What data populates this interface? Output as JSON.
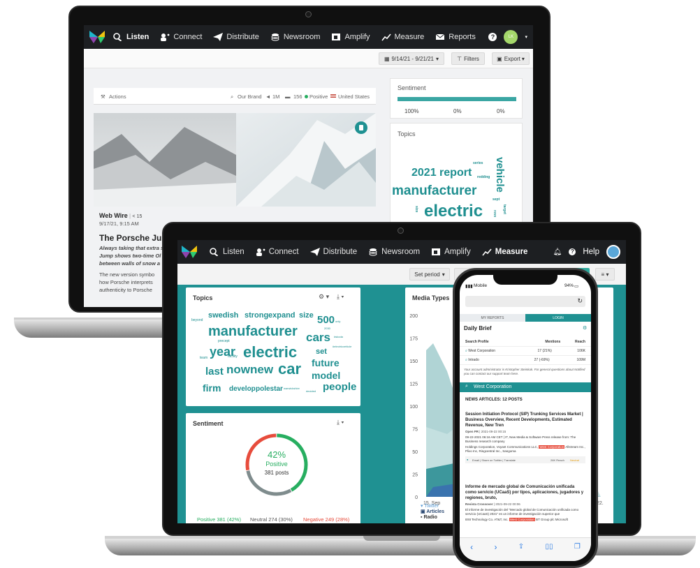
{
  "back_laptop": {
    "nav": {
      "items": [
        {
          "label": "Listen",
          "icon": "listen-icon",
          "active": true
        },
        {
          "label": "Connect",
          "icon": "connect-icon"
        },
        {
          "label": "Distribute",
          "icon": "distribute-icon"
        },
        {
          "label": "Newsroom",
          "icon": "newsroom-icon"
        },
        {
          "label": "Amplify",
          "icon": "amplify-icon"
        },
        {
          "label": "Measure",
          "icon": "measure-icon"
        },
        {
          "label": "Reports",
          "icon": "mail-icon"
        }
      ],
      "help": "?",
      "avatar": "LK"
    },
    "toolbar": {
      "date_range": "9/14/21 - 9/21/21",
      "filters": "Filters",
      "export": "Export"
    },
    "actions": {
      "label": "Actions",
      "brand": "Our Brand",
      "reach": "1M",
      "mentions": "156",
      "sentiment": "Positive",
      "country": "United States"
    },
    "article": {
      "source": "Web Wire",
      "shares": "15",
      "date": "9/17/21, 9:15 AM",
      "title": "The Porsche Jur",
      "lede": [
        "Always taking that extra s",
        "Jump shows two-time Ol",
        "between walls of snow a"
      ],
      "body": [
        "The new version symbo",
        "how Porsche interprets",
        "authenticity to Porsche"
      ]
    },
    "sentiment": {
      "title": "Sentiment",
      "values": [
        "100%",
        "0%",
        "0%"
      ]
    },
    "topics": {
      "title": "Topics",
      "words": [
        "2021 report",
        "manufacturer",
        "electric",
        "vehicle",
        "series",
        "redding",
        "sept",
        "target",
        "reve",
        "size"
      ]
    }
  },
  "front_laptop": {
    "nav": {
      "items": [
        {
          "label": "Listen",
          "icon": "listen-icon"
        },
        {
          "label": "Connect",
          "icon": "connect-icon"
        },
        {
          "label": "Distribute",
          "icon": "distribute-icon"
        },
        {
          "label": "Newsroom",
          "icon": "newsroom-icon"
        },
        {
          "label": "Amplify",
          "icon": "amplify-icon"
        },
        {
          "label": "Measure",
          "icon": "measure-icon",
          "active": true
        }
      ],
      "help": "Help"
    },
    "toolbar": {
      "set_period": "Set period"
    },
    "topics": {
      "title": "Topics",
      "words": [
        {
          "t": "beyond",
          "s": 5
        },
        {
          "t": "swedish",
          "s": 11
        },
        {
          "t": "strong",
          "s": 11
        },
        {
          "t": "expand",
          "s": 11
        },
        {
          "t": "size",
          "s": 11
        },
        {
          "t": "500",
          "s": 15
        },
        {
          "t": "manufacturer",
          "s": 20
        },
        {
          "t": "cars",
          "s": 17
        },
        {
          "t": "year",
          "s": 18
        },
        {
          "t": "electric",
          "s": 22
        },
        {
          "t": "set",
          "s": 11
        },
        {
          "t": "future",
          "s": 14
        },
        {
          "t": "last",
          "s": 15
        },
        {
          "t": "nownew",
          "s": 17
        },
        {
          "t": "car",
          "s": 22
        },
        {
          "t": "model",
          "s": 14
        },
        {
          "t": "firm",
          "s": 14
        },
        {
          "t": "develop",
          "s": 10
        },
        {
          "t": "polestar",
          "s": 10
        },
        {
          "t": "people",
          "s": 15
        },
        {
          "t": "precept",
          "s": 5
        },
        {
          "t": "team",
          "s": 5
        },
        {
          "t": "facility",
          "s": 5
        },
        {
          "t": "warwickshire",
          "s": 4
        },
        {
          "t": "decided",
          "s": 4
        },
        {
          "t": "#electricvehicle",
          "s": 4
        },
        {
          "t": "only",
          "s": 4
        },
        {
          "t": "2030",
          "s": 4
        },
        {
          "t": "#skoda",
          "s": 4
        }
      ]
    },
    "sentiment": {
      "title": "Sentiment",
      "percent": "42%",
      "label": "Positive",
      "posts": "381 posts",
      "positive": "Positive 381 (42%)",
      "neutral": "Neutral 274 (30%)",
      "negative": "Negative 249 (28%)",
      "colors": {
        "positive": "#27ae60",
        "neutral": "#7f8c8d",
        "negative": "#e74c3c"
      },
      "shares": {
        "positive": 42,
        "neutral": 30,
        "negative": 28
      }
    },
    "media_types": {
      "title": "Media Types",
      "yticks": [
        "200",
        "175",
        "150",
        "125",
        "100",
        "75",
        "50",
        "25",
        "0"
      ],
      "xticks": [
        "15. Sep",
        "16. Sep",
        "22."
      ],
      "legend": [
        "Twitter",
        "Articles",
        "Radio"
      ]
    }
  },
  "phone": {
    "status": {
      "carrier": "Mobile",
      "battery": "94%"
    },
    "tabs": [
      "MY REPORTS",
      "LOGIN"
    ],
    "brief_title": "Daily Brief",
    "table": {
      "headers": [
        "Search Profile",
        "Mentions",
        "Reach"
      ],
      "rows": [
        [
          "West Corporation",
          "17 (21%)",
          "106K"
        ],
        [
          "Intrado",
          "27 (-69%)",
          "109M"
        ]
      ]
    },
    "notice": "Your account administrator is Kristopher Steinkuk. For general questions about Notified you can contact our support team here.",
    "search_profile": "West Corporation",
    "news_header": "NEWS ARTICLES: 12 POSTS",
    "articles": [
      {
        "title": "Session Initiation Protocol (SIP) Trunking Services Market | Business Overview, Recent Developments, Estimated Revenue, New Tren",
        "source": "Open PR",
        "date": "2021-09-22 00:15",
        "snippet1": "09-22-2021 06:16 AM CET | IT, New Media & Software Press release from: The Business research company",
        "snippet2": "Holdings Corporation, Voyant Communications LLC,",
        "tag": "West Corporation",
        "snippet3": "Allstream Inc., Plivo Inc, Ringcentral Inc., Sangoma",
        "shares": "Email | Share on Twitter | Translate",
        "reach": "26K Reach",
        "tone": "Neutral"
      },
      {
        "title": "Informe de mercado global de Comunicación unificada como servicio (UCaaS) por tipos, aplicaciones, jugadores y regiones, bruto,",
        "source": "Revista Crossover",
        "date": "2021-09-22 00:06",
        "snippet1": "El informe de investigación del \"Mercado global de Comunicación unificada como servicio (UCaaS) 2021\" es un informe de investigación superior que",
        "snippet2": "8X8 Technology Co. AT&T, Inc.",
        "tag": "West Corporation",
        "snippet3": "BT Group plc Microsoft"
      }
    ]
  }
}
